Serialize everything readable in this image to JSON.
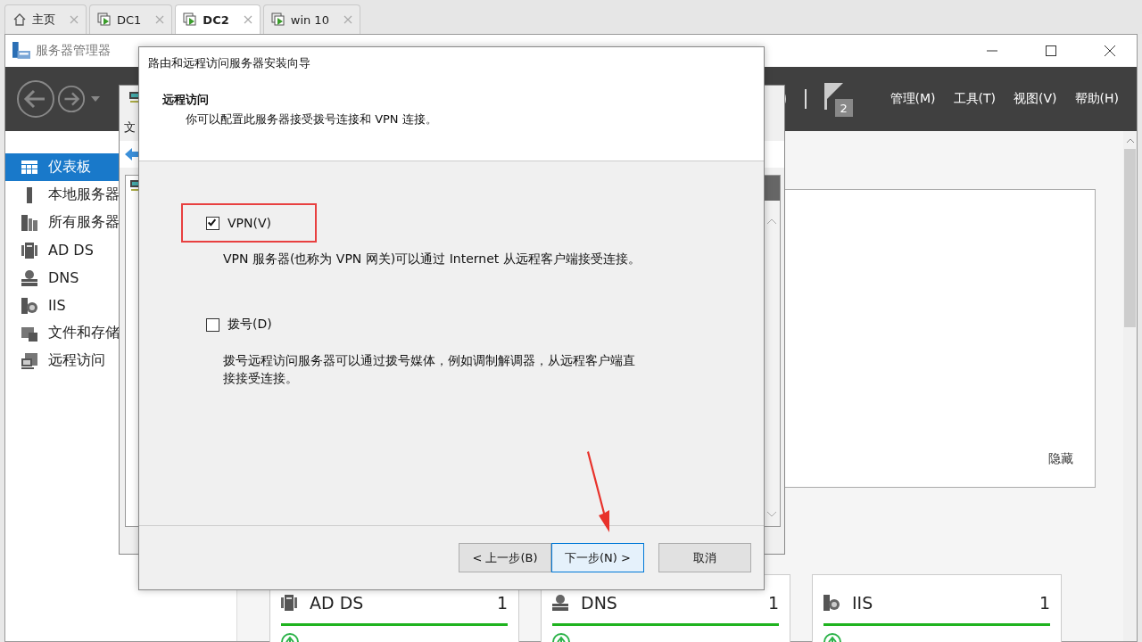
{
  "browser_tabs": [
    {
      "label": "主页",
      "kind": "home",
      "selected": false
    },
    {
      "label": "DC1",
      "kind": "vm",
      "selected": false
    },
    {
      "label": "DC2",
      "kind": "vm",
      "selected": true
    },
    {
      "label": "win 10",
      "kind": "vm",
      "selected": false
    }
  ],
  "window": {
    "title": "服务器管理器"
  },
  "toolbar": {
    "notification_count": "2",
    "menus": [
      "管理(M)",
      "工具(T)",
      "视图(V)",
      "帮助(H)"
    ]
  },
  "sidebar": {
    "items": [
      {
        "label": "仪表板",
        "kind": "dashboard",
        "selected": true
      },
      {
        "label": "本地服务器",
        "kind": "server",
        "selected": false
      },
      {
        "label": "所有服务器",
        "kind": "servers",
        "selected": false
      },
      {
        "label": "AD DS",
        "kind": "adds",
        "selected": false
      },
      {
        "label": "DNS",
        "kind": "dns",
        "selected": false
      },
      {
        "label": "IIS",
        "kind": "iis",
        "selected": false
      },
      {
        "label": "文件和存储",
        "kind": "files",
        "selected": false
      },
      {
        "label": "远程访问",
        "kind": "remote",
        "selected": false
      }
    ]
  },
  "panel": {
    "hide_link": "隐藏"
  },
  "tiles": [
    {
      "title": "AD DS",
      "count": "1",
      "kind": "adds"
    },
    {
      "title": "DNS",
      "count": "1",
      "kind": "dns"
    },
    {
      "title": "IIS",
      "count": "1",
      "kind": "iis"
    }
  ],
  "background_window": {
    "menu": "文"
  },
  "wizard": {
    "title": "路由和远程访问服务器安装向导",
    "heading": "远程访问",
    "subtitle": "你可以配置此服务器接受拨号连接和 VPN 连接。",
    "options": [
      {
        "label": "VPN(V)",
        "checked": true,
        "highlighted": true,
        "description": "VPN 服务器(也称为 VPN 网关)可以通过 Internet 从远程客户端接受连接。"
      },
      {
        "label": "拨号(D)",
        "checked": false,
        "highlighted": false,
        "description": "拨号远程访问服务器可以通过拨号媒体，例如调制解调器，从远程客户端直接接受连接。"
      }
    ],
    "buttons": [
      {
        "label": "< 上一步(B)",
        "selected": false
      },
      {
        "label": "下一步(N) >",
        "selected": true
      },
      {
        "label": "取消",
        "selected": false
      }
    ],
    "annotation_arrow": true
  }
}
